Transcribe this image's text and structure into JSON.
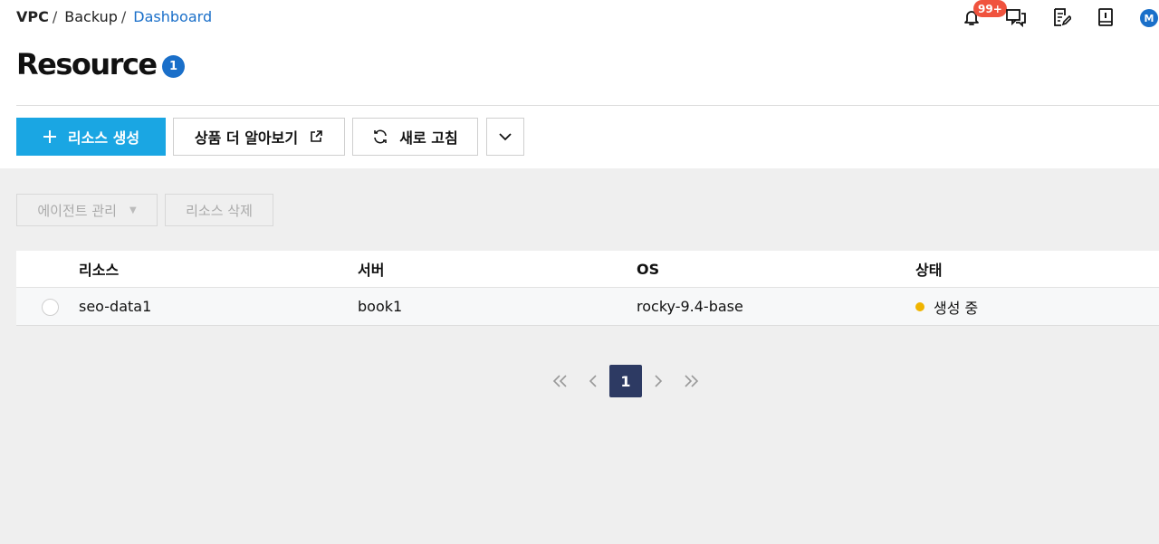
{
  "breadcrumb": {
    "items": [
      "VPC",
      "Backup",
      "Dashboard"
    ],
    "sep": "/"
  },
  "header": {
    "notification_badge": "99+",
    "avatar_initial": "M",
    "icons": [
      "bell-icon",
      "chat-icon",
      "notes-icon",
      "book-icon"
    ]
  },
  "page": {
    "title": "Resource",
    "count": "1"
  },
  "toolbar": {
    "create_label": "리소스 생성",
    "learn_more_label": "상품 더 알아보기",
    "refresh_label": "새로 고침"
  },
  "actions": {
    "agent_label": "에이전트 관리",
    "delete_label": "리소스 삭제"
  },
  "table": {
    "headers": [
      "리소스",
      "서버",
      "OS",
      "상태"
    ],
    "rows": [
      {
        "resource": "seo-data1",
        "server": "book1",
        "os": "rocky-9.4-base",
        "status": "생성 중"
      }
    ]
  },
  "pagination": {
    "current": "1"
  },
  "colors": {
    "accent": "#1aa6e3",
    "link": "#1a6fc9",
    "badge": "#f0533e",
    "status_creating": "#f0b400",
    "page_active": "#2d3a63"
  }
}
